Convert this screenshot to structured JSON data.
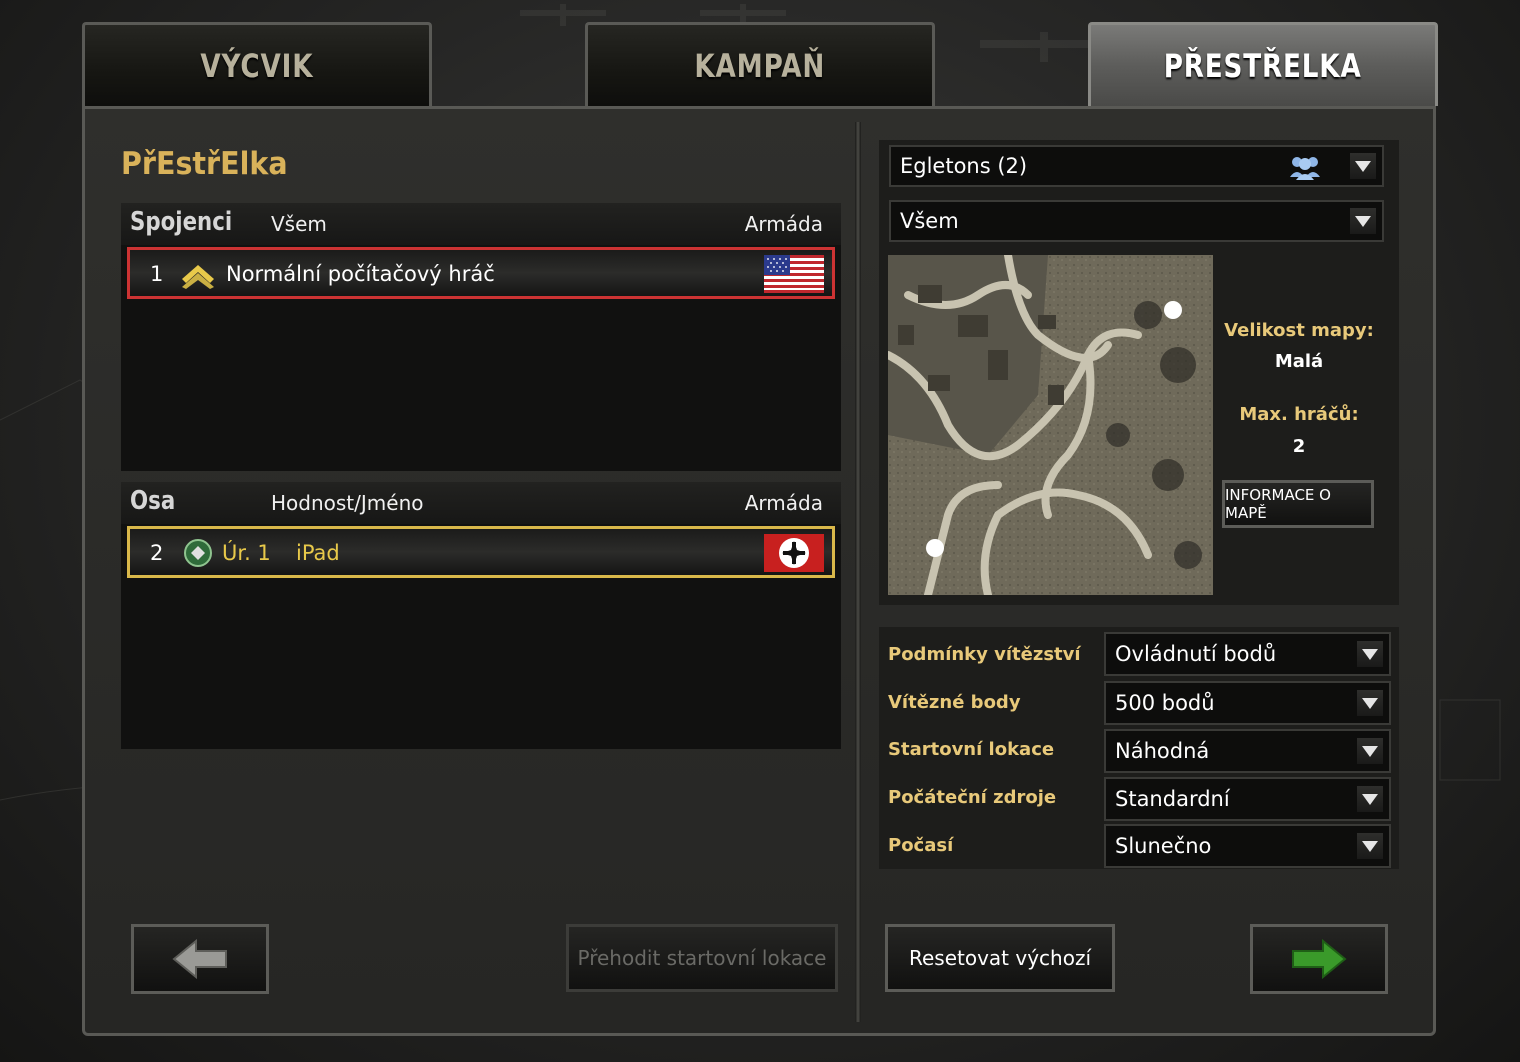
{
  "tabs": [
    {
      "label": "VÝCVIK",
      "active": false
    },
    {
      "label": "KAMPAŇ",
      "active": false
    },
    {
      "label": "PŘESTŘELKA",
      "active": true
    }
  ],
  "title": "PřEstřElka",
  "allies": {
    "team_name": "Spojenci",
    "col_header_1": "Všem",
    "col_header_2": "Armáda",
    "players": [
      {
        "number": "1",
        "name": "Normální počítačový hráč",
        "army": "USA",
        "rank_icon": "chevron-rank-icon"
      }
    ]
  },
  "axis": {
    "team_name": "Osa",
    "col_header_1": "Hodnost/Jméno",
    "col_header_2": "Armáda",
    "players": [
      {
        "number": "2",
        "level": "Úr. 1",
        "name": "iPad",
        "army": "Wehrmacht",
        "rank_icon": "green-diamond-rank-icon"
      }
    ]
  },
  "map": {
    "selected": "Egletons (2)",
    "filter": "Všem",
    "size_label": "Velikost mapy:",
    "size_value": "Malá",
    "max_players_label": "Max. hráčů:",
    "max_players_value": "2",
    "info_button": "INFORMACE O MAPĚ"
  },
  "settings": [
    {
      "label": "Podmínky vítězství",
      "value": "Ovládnutí bodů"
    },
    {
      "label": "Vítězné body",
      "value": "500 bodů"
    },
    {
      "label": "Startovní lokace",
      "value": "Náhodná"
    },
    {
      "label": "Počáteční zdroje",
      "value": "Standardní"
    },
    {
      "label": "Počasí",
      "value": "Slunečno"
    }
  ],
  "buttons": {
    "swap_start": "Přehodit startovní lokace",
    "reset_default": "Resetovat výchozí"
  },
  "colors": {
    "accent_gold": "#d9b25a",
    "allies_border": "#cc3333",
    "axis_border": "#d9b84a",
    "next_arrow": "#3a9a2a"
  }
}
